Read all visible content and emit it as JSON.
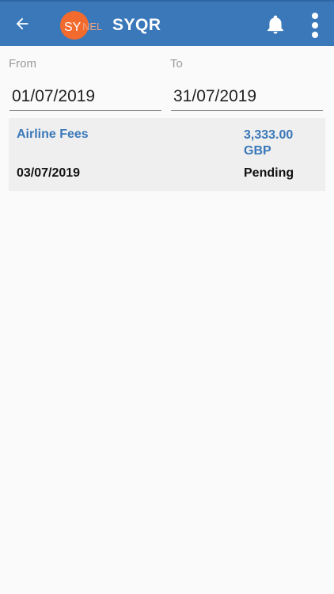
{
  "appbar": {
    "title": "SYQR",
    "logo_text_left": "SY",
    "logo_text_right": "NEL",
    "back_icon": "arrow-left-icon",
    "notification_icon": "bell-icon",
    "menu_icon": "more-vertical-icon",
    "background_color": "#3a78b9",
    "logo_color": "#f26a2e"
  },
  "filters": {
    "from_label": "From",
    "from_value": "01/07/2019",
    "to_label": "To",
    "to_value": "31/07/2019"
  },
  "expenses": [
    {
      "name": "Airline Fees",
      "amount": "3,333.00",
      "currency": "GBP",
      "date": "03/07/2019",
      "status": "Pending"
    }
  ]
}
